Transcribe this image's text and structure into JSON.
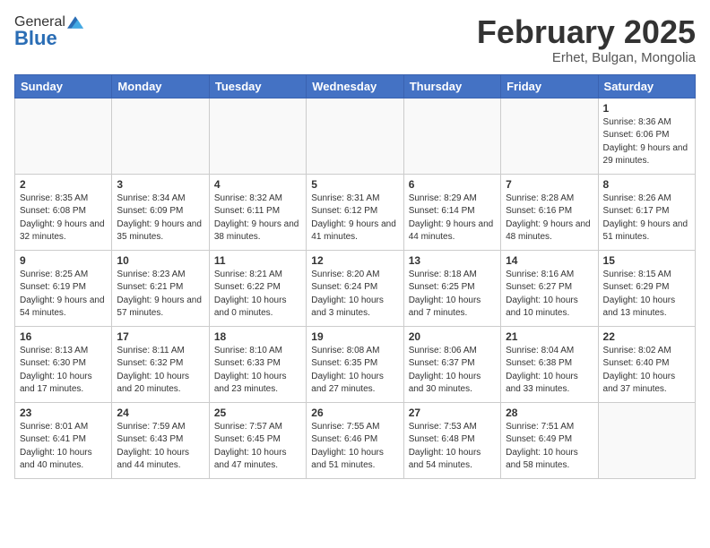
{
  "header": {
    "logo_general": "General",
    "logo_blue": "Blue",
    "month_title": "February 2025",
    "subtitle": "Erhet, Bulgan, Mongolia"
  },
  "weekdays": [
    "Sunday",
    "Monday",
    "Tuesday",
    "Wednesday",
    "Thursday",
    "Friday",
    "Saturday"
  ],
  "weeks": [
    [
      {
        "day": "",
        "info": ""
      },
      {
        "day": "",
        "info": ""
      },
      {
        "day": "",
        "info": ""
      },
      {
        "day": "",
        "info": ""
      },
      {
        "day": "",
        "info": ""
      },
      {
        "day": "",
        "info": ""
      },
      {
        "day": "1",
        "info": "Sunrise: 8:36 AM\nSunset: 6:06 PM\nDaylight: 9 hours and 29 minutes."
      }
    ],
    [
      {
        "day": "2",
        "info": "Sunrise: 8:35 AM\nSunset: 6:08 PM\nDaylight: 9 hours and 32 minutes."
      },
      {
        "day": "3",
        "info": "Sunrise: 8:34 AM\nSunset: 6:09 PM\nDaylight: 9 hours and 35 minutes."
      },
      {
        "day": "4",
        "info": "Sunrise: 8:32 AM\nSunset: 6:11 PM\nDaylight: 9 hours and 38 minutes."
      },
      {
        "day": "5",
        "info": "Sunrise: 8:31 AM\nSunset: 6:12 PM\nDaylight: 9 hours and 41 minutes."
      },
      {
        "day": "6",
        "info": "Sunrise: 8:29 AM\nSunset: 6:14 PM\nDaylight: 9 hours and 44 minutes."
      },
      {
        "day": "7",
        "info": "Sunrise: 8:28 AM\nSunset: 6:16 PM\nDaylight: 9 hours and 48 minutes."
      },
      {
        "day": "8",
        "info": "Sunrise: 8:26 AM\nSunset: 6:17 PM\nDaylight: 9 hours and 51 minutes."
      }
    ],
    [
      {
        "day": "9",
        "info": "Sunrise: 8:25 AM\nSunset: 6:19 PM\nDaylight: 9 hours and 54 minutes."
      },
      {
        "day": "10",
        "info": "Sunrise: 8:23 AM\nSunset: 6:21 PM\nDaylight: 9 hours and 57 minutes."
      },
      {
        "day": "11",
        "info": "Sunrise: 8:21 AM\nSunset: 6:22 PM\nDaylight: 10 hours and 0 minutes."
      },
      {
        "day": "12",
        "info": "Sunrise: 8:20 AM\nSunset: 6:24 PM\nDaylight: 10 hours and 3 minutes."
      },
      {
        "day": "13",
        "info": "Sunrise: 8:18 AM\nSunset: 6:25 PM\nDaylight: 10 hours and 7 minutes."
      },
      {
        "day": "14",
        "info": "Sunrise: 8:16 AM\nSunset: 6:27 PM\nDaylight: 10 hours and 10 minutes."
      },
      {
        "day": "15",
        "info": "Sunrise: 8:15 AM\nSunset: 6:29 PM\nDaylight: 10 hours and 13 minutes."
      }
    ],
    [
      {
        "day": "16",
        "info": "Sunrise: 8:13 AM\nSunset: 6:30 PM\nDaylight: 10 hours and 17 minutes."
      },
      {
        "day": "17",
        "info": "Sunrise: 8:11 AM\nSunset: 6:32 PM\nDaylight: 10 hours and 20 minutes."
      },
      {
        "day": "18",
        "info": "Sunrise: 8:10 AM\nSunset: 6:33 PM\nDaylight: 10 hours and 23 minutes."
      },
      {
        "day": "19",
        "info": "Sunrise: 8:08 AM\nSunset: 6:35 PM\nDaylight: 10 hours and 27 minutes."
      },
      {
        "day": "20",
        "info": "Sunrise: 8:06 AM\nSunset: 6:37 PM\nDaylight: 10 hours and 30 minutes."
      },
      {
        "day": "21",
        "info": "Sunrise: 8:04 AM\nSunset: 6:38 PM\nDaylight: 10 hours and 33 minutes."
      },
      {
        "day": "22",
        "info": "Sunrise: 8:02 AM\nSunset: 6:40 PM\nDaylight: 10 hours and 37 minutes."
      }
    ],
    [
      {
        "day": "23",
        "info": "Sunrise: 8:01 AM\nSunset: 6:41 PM\nDaylight: 10 hours and 40 minutes."
      },
      {
        "day": "24",
        "info": "Sunrise: 7:59 AM\nSunset: 6:43 PM\nDaylight: 10 hours and 44 minutes."
      },
      {
        "day": "25",
        "info": "Sunrise: 7:57 AM\nSunset: 6:45 PM\nDaylight: 10 hours and 47 minutes."
      },
      {
        "day": "26",
        "info": "Sunrise: 7:55 AM\nSunset: 6:46 PM\nDaylight: 10 hours and 51 minutes."
      },
      {
        "day": "27",
        "info": "Sunrise: 7:53 AM\nSunset: 6:48 PM\nDaylight: 10 hours and 54 minutes."
      },
      {
        "day": "28",
        "info": "Sunrise: 7:51 AM\nSunset: 6:49 PM\nDaylight: 10 hours and 58 minutes."
      },
      {
        "day": "",
        "info": ""
      }
    ]
  ]
}
